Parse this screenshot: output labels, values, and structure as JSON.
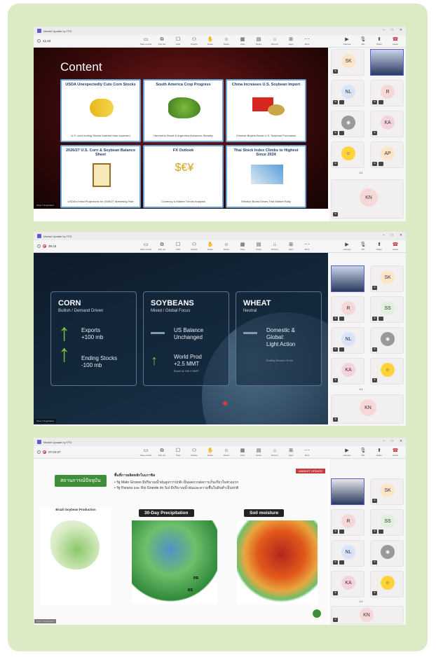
{
  "meetings": [
    {
      "title": "Market Update by TFD",
      "time": "41:43",
      "slide": {
        "heading": "Content",
        "cards": [
          {
            "title": "USDA Unexpectedly Cuts Corn Stocks",
            "caption": "U.S. corn ending Stocks lowered than expected"
          },
          {
            "title": "South America Crop Progress",
            "caption": "Harvest in Brazil & Argentina Advances Steadily"
          },
          {
            "title": "China Increases U.S. Soybean Import",
            "caption": "Chinese Buyers Boost U.S. Soybean Purchases"
          },
          {
            "title": "2026/27 U.S. Corn & Soybean Balance Sheet",
            "caption": "USDA's Initial Projections for 2026/27 Marketing Year"
          },
          {
            "title": "FX Outlook",
            "caption": "Currency & Market Trends Analysis"
          },
          {
            "title": "Thai Stock Index Climbs to Highest Since 2024",
            "caption": "Election Boost Drives Thai Market Rally"
          }
        ]
      },
      "presenter": "Pipat J Nopphakun",
      "participants": [
        "SK",
        "NL",
        "R",
        "KA",
        "AP"
      ],
      "page": "1/4",
      "large": "KN"
    },
    {
      "title": "Market Update by TFD",
      "time": "38:15",
      "slide": {
        "crops": [
          {
            "name": "CORN",
            "sub": "Bullish / Demand Driven",
            "l1": "Exports",
            "v1": "+100 mb",
            "l2": "Ending Stocks",
            "v2": "-100 mb"
          },
          {
            "name": "SOYBEANS",
            "sub": "Mixed / Global Focus",
            "l1": "US Balance",
            "v1": "Unchanged",
            "l2": "World Prod",
            "v2": "+2.5 MMT",
            "note": "Brazil at 180.0 MMT"
          },
          {
            "name": "WHEAT",
            "sub": "Neutral",
            "l1": "Domestic &",
            "v1": "Global:",
            "l2": "Light Action",
            "v2": "",
            "note": "Ending Stocks +5 mb"
          }
        ]
      },
      "presenter": "Pipat J Nopphakun",
      "participants": [
        "SK",
        "R",
        "SS",
        "NL",
        "KA"
      ],
      "page": "1/4",
      "large": "KN"
    },
    {
      "title": "Market Update by TFD",
      "time": "07:02:07",
      "slide": {
        "badge": "สถานการณ์ปัจจุบัน",
        "heading": "พื้นที่การผลิตหลักในบราซิล",
        "bullets": [
          "รัฐ Mato Grosso มีปริมาณน้ำฝนสูงกว่าปกติ เป็นผลบวกต่อการเก็บเกี่ยวในช่วงแรก",
          "รัฐ Parana และ Rio Grande do Sul มีปริมาณน้ำฝนและความชื้นในดินต่ำเป็นปกติ"
        ],
        "maps": [
          {
            "title": "Brazil Soybean Production"
          },
          {
            "title": "30-Day Precipitation"
          },
          {
            "title": "Soil moisture"
          }
        ],
        "tag": "MARKET UPDATE",
        "labels": [
          "PR",
          "RS"
        ]
      },
      "presenter": "Pipat J Nopphakun",
      "participants": [
        "SK",
        "R",
        "SS",
        "NL",
        "KA"
      ],
      "page": "1/4",
      "large": "KN"
    }
  ],
  "toolbar": [
    "Take control",
    "Pop out",
    "Chat",
    "People",
    "Raise",
    "React",
    "View",
    "Notes",
    "Rooms",
    "Apps",
    "More",
    "Camera",
    "Mic",
    "Share",
    "Leave"
  ]
}
